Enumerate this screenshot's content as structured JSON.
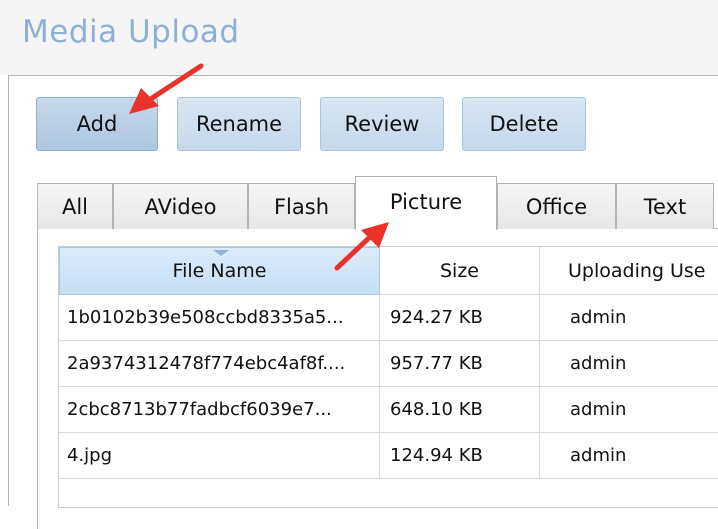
{
  "title": "Media Upload",
  "toolbar": {
    "add_label": "Add",
    "rename_label": "Rename",
    "review_label": "Review",
    "delete_label": "Delete"
  },
  "tabs": [
    {
      "label": "All"
    },
    {
      "label": "AVideo"
    },
    {
      "label": "Flash"
    },
    {
      "label": "Picture",
      "active": true
    },
    {
      "label": "Office"
    },
    {
      "label": "Text"
    }
  ],
  "table": {
    "columns": [
      "File Name",
      "Size",
      "Uploading Use"
    ],
    "rows": [
      {
        "name": "1b0102b39e508ccbd8335a5...",
        "size": "924.27 KB",
        "user": "admin"
      },
      {
        "name": "2a9374312478f774ebc4af8f....",
        "size": "957.77 KB",
        "user": "admin"
      },
      {
        "name": "2cbc8713b77fadbcf6039e7...",
        "size": "648.10 KB",
        "user": "admin"
      },
      {
        "name": "4.jpg",
        "size": "124.94 KB",
        "user": "admin"
      }
    ]
  },
  "colors": {
    "title": "#8fb0d4",
    "button_bg": "#c5d8ea",
    "header_selected": "#c6def5",
    "annotation_arrow": "#e8322a"
  },
  "icons": [
    "sort-indicator-icon",
    "annotation-arrow-icon"
  ]
}
